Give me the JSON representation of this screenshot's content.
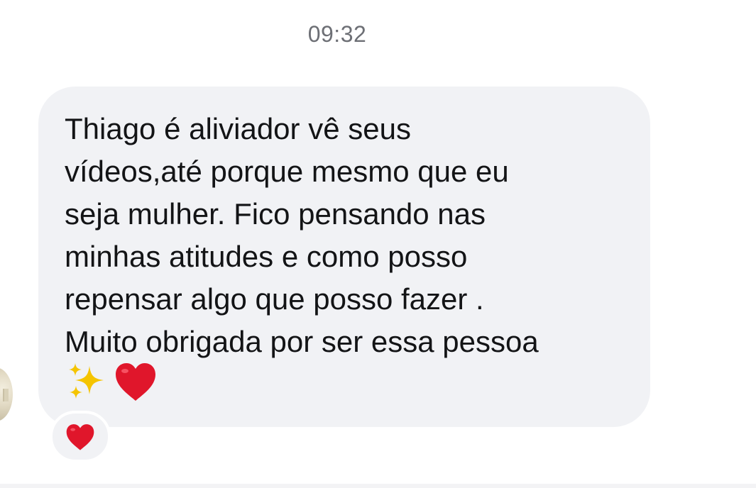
{
  "chat": {
    "timestamp": "09:32",
    "message": {
      "text": "Thiago é aliviador vê seus\nvídeos,até porque mesmo que eu\nseja mulher. Fico pensando nas\nminhas atitudes e como posso\nrepensar algo que posso fazer .\nMuito obrigada por ser essa pessoa",
      "emojis": [
        "sparkles-icon",
        "red-heart-icon"
      ]
    },
    "reaction": {
      "icon": "red-heart-icon"
    }
  },
  "colors": {
    "bubble_background": "#f1f2f5",
    "timestamp_text": "#6d6f75",
    "message_text": "#131416",
    "heart_red": "#e0162b",
    "sparkle_gold": "#f5c400"
  }
}
